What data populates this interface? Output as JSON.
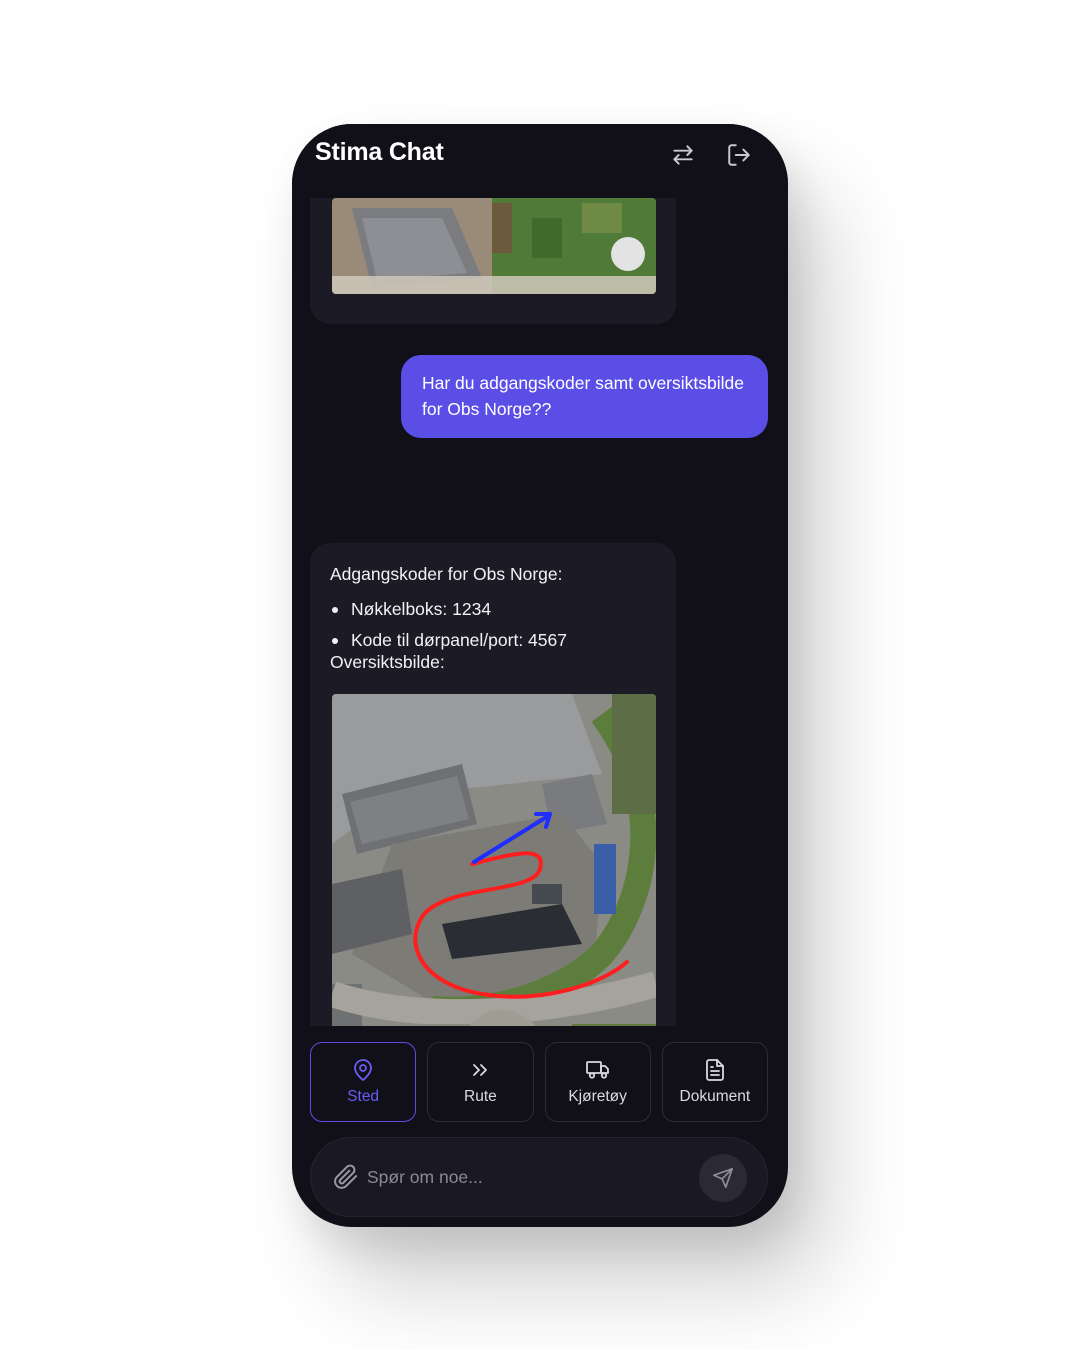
{
  "app": {
    "title": "Stima Chat"
  },
  "header": {
    "switch_icon": "arrows-left-right-icon",
    "logout_icon": "log-out-icon"
  },
  "messages": [
    {
      "role": "assistant",
      "type": "image",
      "image_name": "satellite-map-image"
    },
    {
      "role": "user",
      "text": "Har du adgangskoder samt oversiktsbilde for Obs Norge??"
    },
    {
      "role": "assistant",
      "heading": "Adgangskoder for Obs Norge:",
      "items": [
        "Nøkkelboks: 1234",
        "Kode til dørpanel/port: 4567"
      ],
      "footer": "Oversiktsbilde:",
      "image_name": "overview-map-image"
    }
  ],
  "actions": [
    {
      "label": "Sted",
      "icon": "map-pin-icon",
      "active": true
    },
    {
      "label": "Rute",
      "icon": "chevrons-right-icon",
      "active": false
    },
    {
      "label": "Kjøretøy",
      "icon": "truck-icon",
      "active": false
    },
    {
      "label": "Dokument",
      "icon": "file-text-icon",
      "active": false
    }
  ],
  "composer": {
    "placeholder": "Spør om noe...",
    "attach_icon": "paperclip-icon",
    "send_icon": "send-icon"
  },
  "colors": {
    "accent": "#5b4ee6",
    "background": "#111018",
    "bubble": "#1c1b25"
  }
}
